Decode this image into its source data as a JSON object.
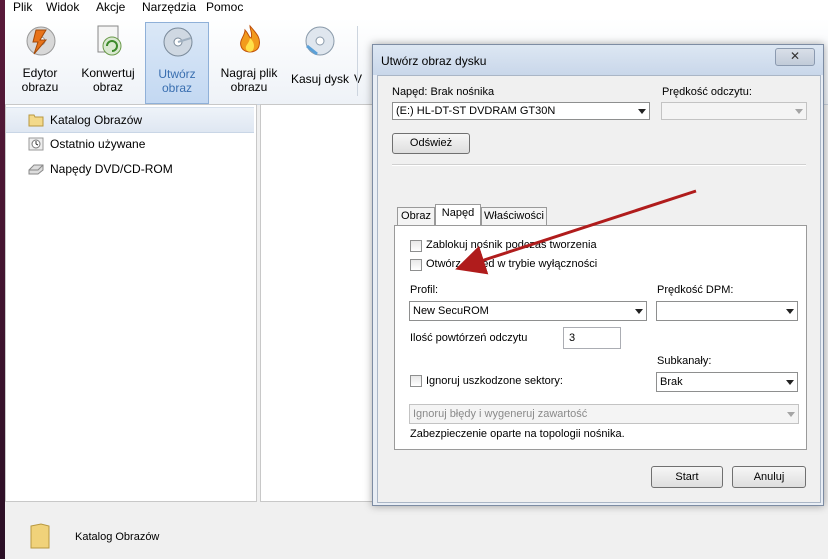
{
  "menubar": {
    "items": [
      "Plik",
      "Widok",
      "Akcje",
      "Narzędzia",
      "Pomoc"
    ]
  },
  "toolbar": {
    "buttons": [
      {
        "label_line1": "Edytor",
        "label_line2": "obrazu",
        "icon": "image-editor-icon"
      },
      {
        "label_line1": "Konwertuj",
        "label_line2": "obraz",
        "icon": "convert-image-icon"
      },
      {
        "label_line1": "Utwórz",
        "label_line2": "obraz",
        "icon": "create-image-icon"
      },
      {
        "label_line1": "Nagraj plik",
        "label_line2": "obrazu",
        "icon": "burn-image-icon"
      },
      {
        "label_line1": "Kasuj dysk",
        "label_line2": "",
        "icon": "erase-disc-icon"
      },
      {
        "label_line1": "V",
        "label_line2": "",
        "icon": "virtual-drive-icon"
      }
    ]
  },
  "sidebar": {
    "items": [
      {
        "label": "Katalog Obrazów",
        "icon": "folder-icon",
        "selected": true
      },
      {
        "label": "Ostatnio używane",
        "icon": "clock-icon",
        "selected": false
      },
      {
        "label": "Napędy DVD/CD-ROM",
        "icon": "dvd-drive-icon",
        "selected": false
      }
    ]
  },
  "statusbar": {
    "label": "Katalog Obrazów",
    "icon": "folder-icon"
  },
  "dialog": {
    "title": "Utwórz obraz dysku",
    "close_label": "✕",
    "drive_label": "Napęd: Brak nośnika",
    "drive_value": "(E:) HL-DT-ST DVDRAM GT30N",
    "read_speed_label": "Prędkość odczytu:",
    "read_speed_value": "",
    "refresh_label": "Odśwież",
    "tabs": [
      "Obraz",
      "Napęd",
      "Właściwości"
    ],
    "active_tab": "Napęd",
    "lock_media_label": "Zablokuj nośnik podczas tworzenia",
    "exclusive_label": "Otwórz napęd w trybie wyłączności",
    "profile_label": "Profil:",
    "profile_value": "New SecuROM",
    "dpm_label": "Prędkość DPM:",
    "dpm_value": "",
    "retries_label": "Ilość powtórzeń odczytu",
    "retries_value": "3",
    "subchannels_label": "Subkanały:",
    "subchannels_value": "Brak",
    "ignore_bad_label": "Ignoruj uszkodzone sektory:",
    "ignore_errors_value": "Ignoruj błędy i wygeneruj zawartość",
    "protection_text": "Zabezpieczenie oparte na topologii nośnika.",
    "start_label": "Start",
    "cancel_label": "Anuluj"
  },
  "colors": {
    "accent": "#3a6fb0",
    "annotation_arrow": "#b01c1c"
  }
}
